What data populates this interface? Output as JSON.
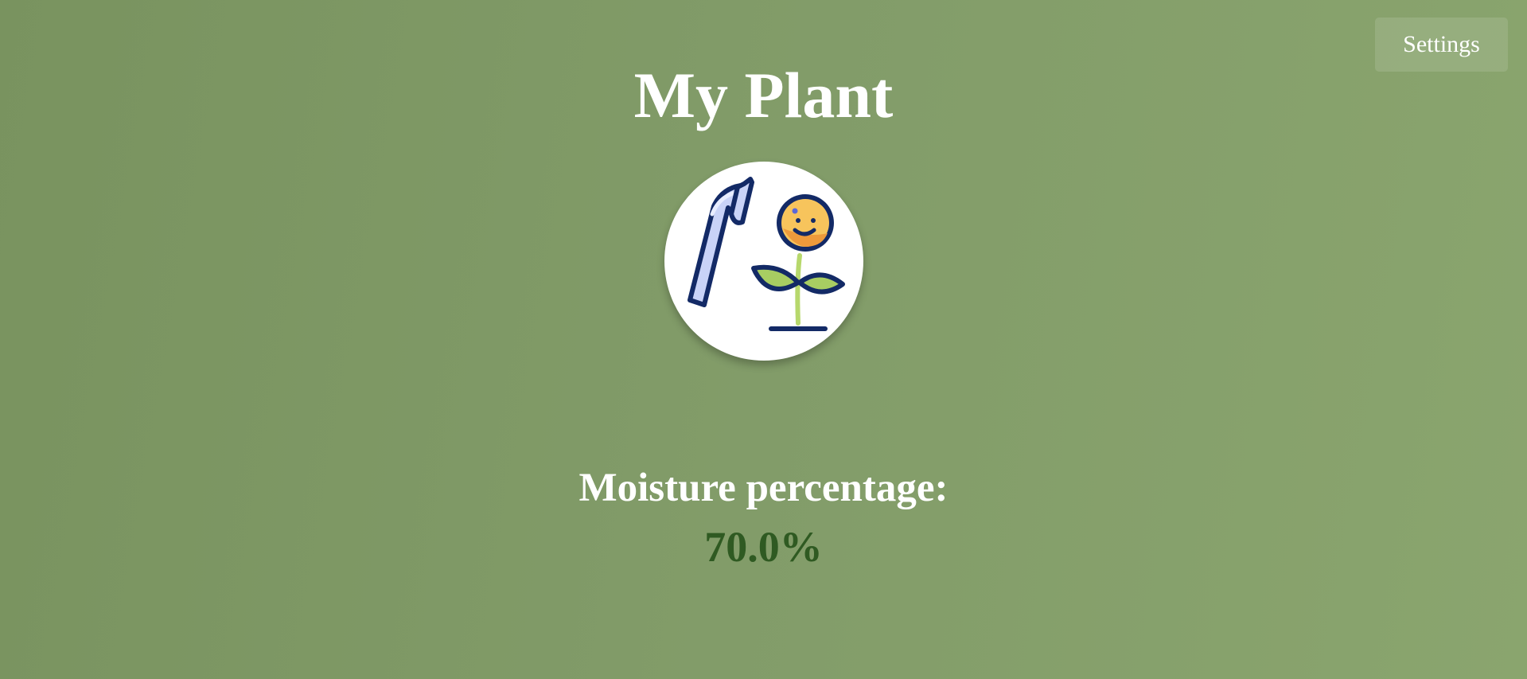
{
  "header": {
    "title": "My Plant",
    "settings_label": "Settings"
  },
  "avatar": {
    "icon": "watering-plant-icon"
  },
  "moisture": {
    "label": "Moisture percentage:",
    "value": "70.0%",
    "value_color": "#2f5a22"
  },
  "colors": {
    "background": "#829c69",
    "text": "#ffffff"
  }
}
